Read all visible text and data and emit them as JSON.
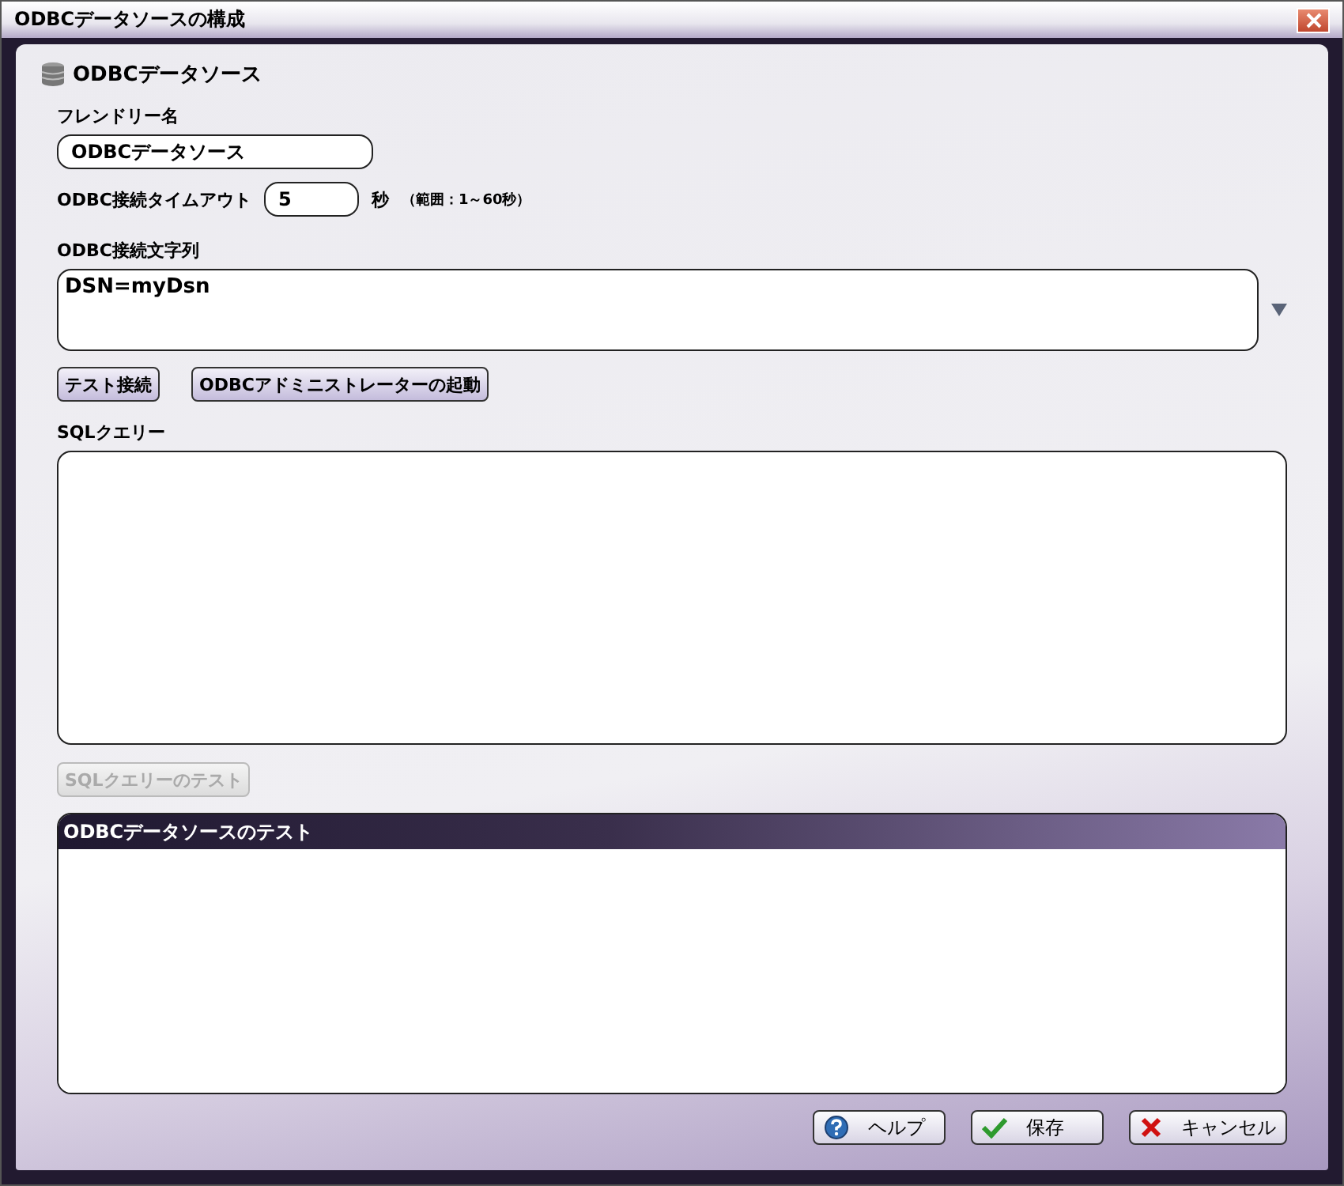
{
  "window": {
    "title": "ODBCデータソースの構成"
  },
  "section": {
    "title": "ODBCデータソース"
  },
  "friendly_name": {
    "label": "フレンドリー名",
    "value": "ODBCデータソース"
  },
  "timeout": {
    "label": "ODBC接続タイムアウト",
    "value": "5",
    "unit": "秒",
    "range": "（範囲：1～60秒）"
  },
  "connection_string": {
    "label": "ODBC接続文字列",
    "value": "DSN=myDsn"
  },
  "connection_buttons": [
    {
      "label": "テスト接続",
      "disabled": false
    },
    {
      "label": "ODBCアドミニストレーターの起動",
      "disabled": false
    }
  ],
  "sql_query": {
    "label": "SQLクエリー"
  },
  "sql_test_button": {
    "label": "SQLクエリーのテスト",
    "disabled": true
  },
  "test_panel": {
    "title": "ODBCデータソースのテスト"
  },
  "footer_buttons": [
    {
      "kind": "help",
      "label": "ヘルプ"
    },
    {
      "kind": "save",
      "label": "保存"
    },
    {
      "kind": "cancel",
      "label": "キャンセル"
    }
  ]
}
